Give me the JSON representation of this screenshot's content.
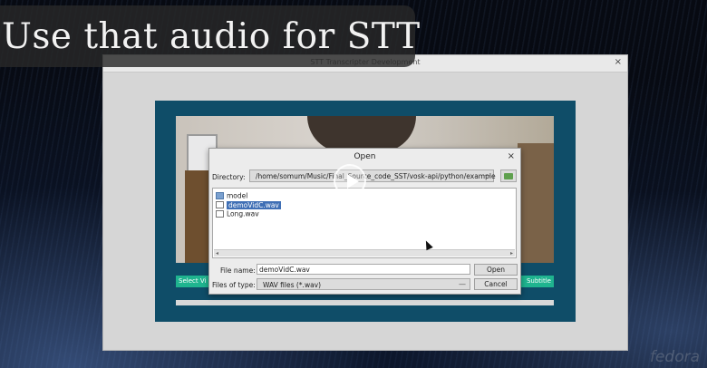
{
  "caption": {
    "text": "Use that audio for STT"
  },
  "watermark": "fedora",
  "main_window": {
    "title": "STT Transcripter Development",
    "close_glyph": "×",
    "select_button": "Select Vi",
    "subtitle_button": "Subtitle"
  },
  "dialog": {
    "title": "Open",
    "close_glyph": "×",
    "directory_label": "Directory:",
    "directory_value": "/home/somum/Music/Final_Source_code_SST/vosk-api/python/example",
    "combo_arrow": "—",
    "files": [
      {
        "name": "model",
        "type": "folder",
        "selected": false
      },
      {
        "name": "demoVidC.wav",
        "type": "file",
        "selected": true
      },
      {
        "name": "Long.wav",
        "type": "file",
        "selected": false
      }
    ],
    "scroll_left": "◂",
    "scroll_right": "▸",
    "file_name_label": "File name:",
    "file_name_value": "demoVidC.wav",
    "files_of_type_label": "Files of type:",
    "files_of_type_value": "WAV files (*.wav)",
    "open_button": "Open",
    "cancel_button": "Cancel"
  }
}
